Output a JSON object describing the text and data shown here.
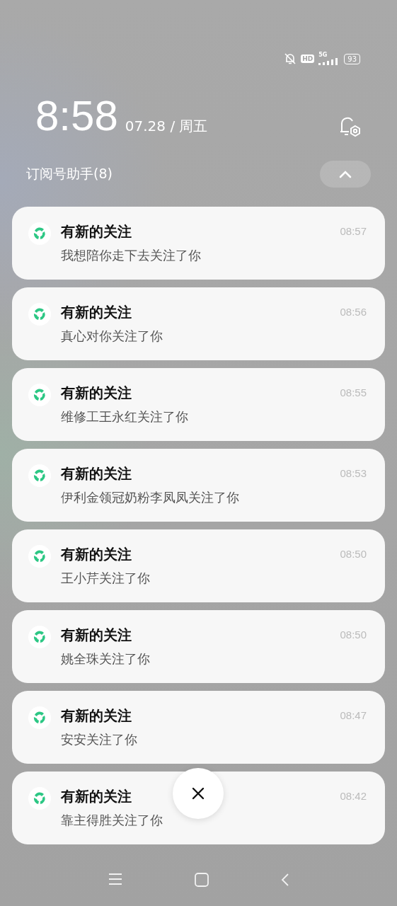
{
  "status_bar": {
    "hd": "HD",
    "network": "5G",
    "battery": "93"
  },
  "header": {
    "time": "8:58",
    "date": "07.28 / 周五"
  },
  "group": {
    "title": "订阅号助手(8)",
    "expanded": true
  },
  "notifications": [
    {
      "title": "有新的关注",
      "body": "我想陪你走下去关注了你",
      "time": "08:57"
    },
    {
      "title": "有新的关注",
      "body": "真心对你关注了你",
      "time": "08:56"
    },
    {
      "title": "有新的关注",
      "body": "维修工王永红关注了你",
      "time": "08:55"
    },
    {
      "title": "有新的关注",
      "body": "伊利金领冠奶粉李凤凤关注了你",
      "time": "08:53"
    },
    {
      "title": "有新的关注",
      "body": "王小芹关注了你",
      "time": "08:50"
    },
    {
      "title": "有新的关注",
      "body": "姚全珠关注了你",
      "time": "08:50"
    },
    {
      "title": "有新的关注",
      "body": "安安关注了你",
      "time": "08:47"
    },
    {
      "title": "有新的关注",
      "body": "靠主得胜关注了你",
      "time": "08:42"
    }
  ]
}
